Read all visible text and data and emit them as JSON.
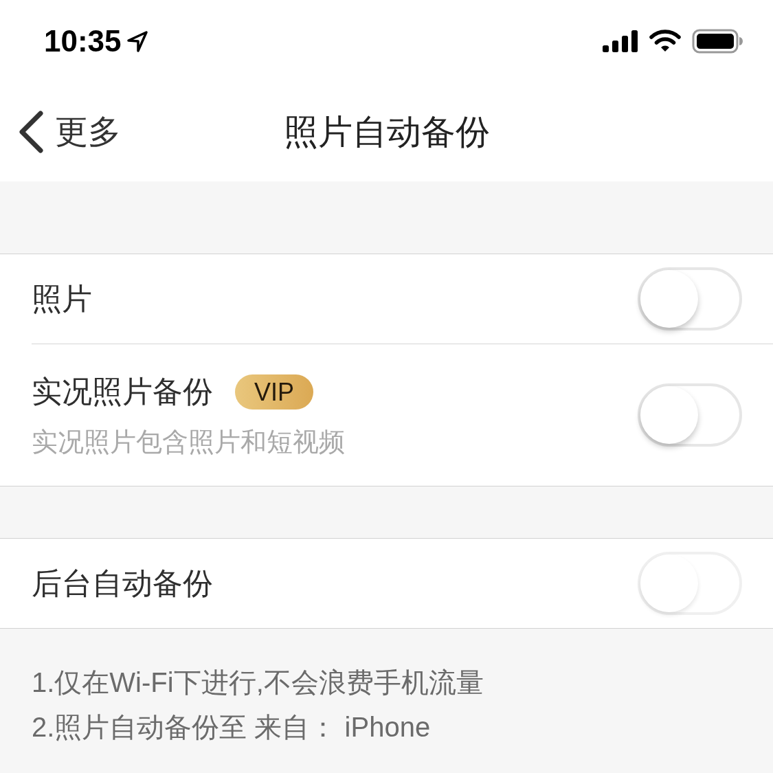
{
  "status_bar": {
    "time": "10:35"
  },
  "nav": {
    "back_label": "更多",
    "title": "照片自动备份"
  },
  "groups": [
    {
      "rows": [
        {
          "label": "照片",
          "on": false,
          "disabled": false
        },
        {
          "label": "实况照片备份",
          "badge": "VIP",
          "subtitle": "实况照片包含照片和短视频",
          "on": false,
          "disabled": false
        }
      ]
    },
    {
      "rows": [
        {
          "label": "后台自动备份",
          "on": false,
          "disabled": true
        }
      ]
    }
  ],
  "notes": [
    "1.仅在Wi-Fi下进行,不会浪费手机流量",
    "2.照片自动备份至 来自： iPhone"
  ]
}
